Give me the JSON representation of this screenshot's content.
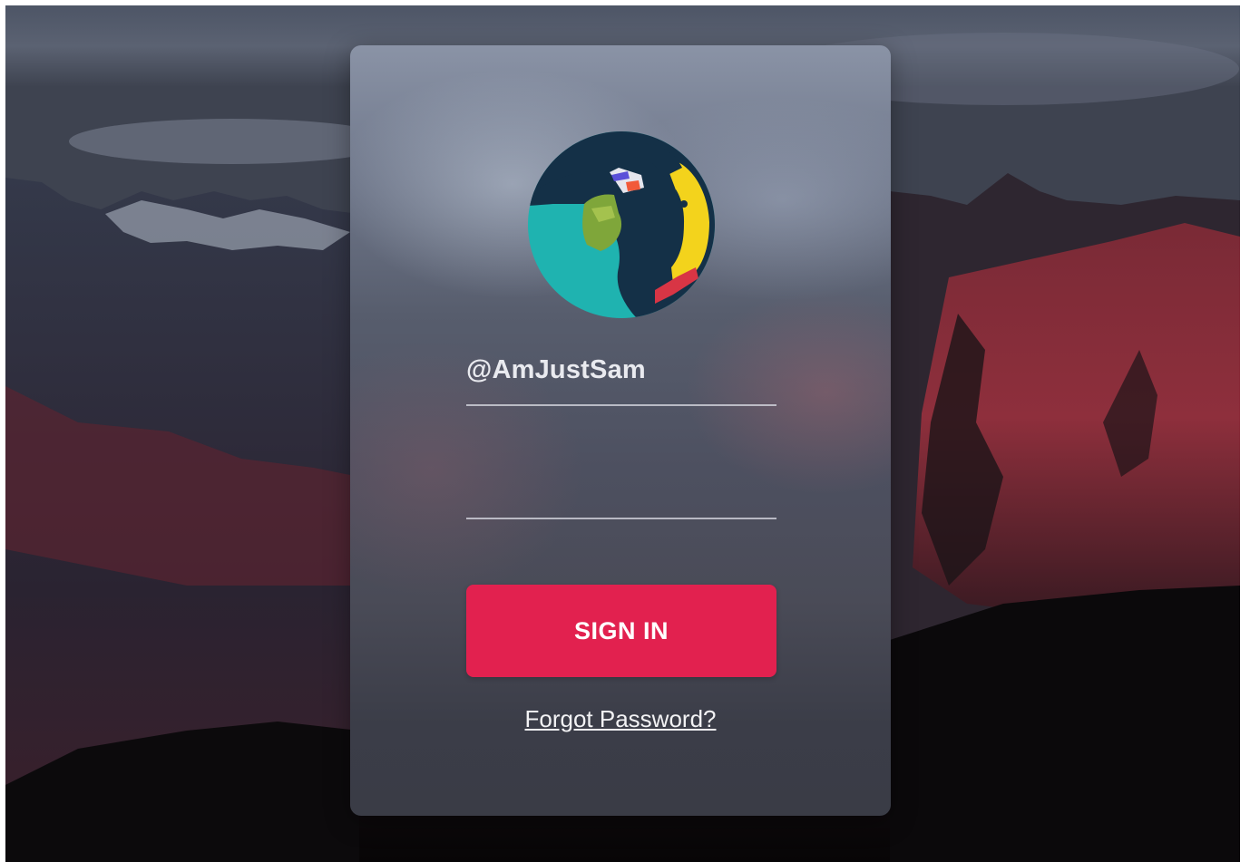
{
  "login": {
    "username": "@AmJustSam",
    "password_value": "",
    "signin_label": "SIGN IN",
    "forgot_label": "Forgot Password?"
  },
  "colors": {
    "accent": "#e2214f",
    "avatar_teal": "#1fb3b0",
    "avatar_navy": "#143047"
  },
  "icons": {
    "avatar": "user-avatar-illustration"
  }
}
